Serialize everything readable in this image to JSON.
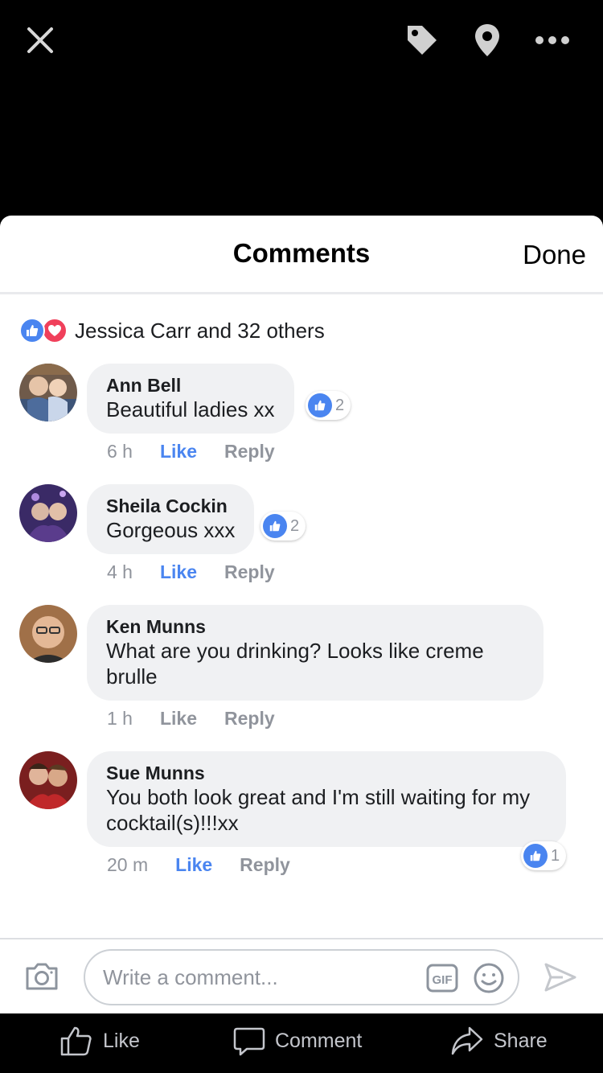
{
  "topbar": {
    "close_icon": "close-icon",
    "tag_icon": "tag-icon",
    "location_icon": "location-pin-icon",
    "more_icon": "more-icon"
  },
  "sheet": {
    "title": "Comments",
    "done_label": "Done"
  },
  "reactions": {
    "summary": "Jessica Carr and 32 others",
    "types": [
      "like",
      "love"
    ],
    "colors": {
      "like": "#4a85f0",
      "love": "#f0405b"
    }
  },
  "comments": [
    {
      "name": "Ann Bell",
      "text": "Beautiful ladies xx",
      "time": "6 h",
      "like_label": "Like",
      "reply_label": "Reply",
      "likes": "2",
      "liked": true
    },
    {
      "name": "Sheila Cockin",
      "text": "Gorgeous xxx",
      "time": "4 h",
      "like_label": "Like",
      "reply_label": "Reply",
      "likes": "2",
      "liked": true
    },
    {
      "name": "Ken Munns",
      "text": "What are you drinking? Looks like creme brulle",
      "time": "1 h",
      "like_label": "Like",
      "reply_label": "Reply",
      "likes": "",
      "liked": false
    },
    {
      "name": "Sue Munns",
      "text": "You both look great and I'm still waiting for my cocktail(s)!!!xx",
      "time": "20 m",
      "like_label": "Like",
      "reply_label": "Reply",
      "likes": "1",
      "liked": true
    }
  ],
  "composer": {
    "placeholder": "Write a comment...",
    "camera_icon": "camera-icon",
    "gif_icon": "gif-icon",
    "emoji_icon": "emoji-icon",
    "send_icon": "send-icon"
  },
  "actions": {
    "like": "Like",
    "comment": "Comment",
    "share": "Share"
  },
  "colors": {
    "accent": "#4a85f0",
    "bubble": "#f0f1f3",
    "meta": "#90949c"
  }
}
